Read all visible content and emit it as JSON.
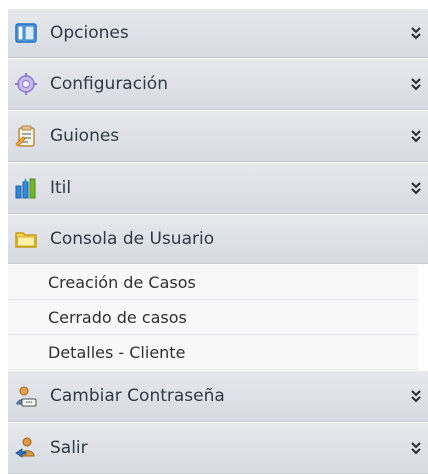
{
  "menu": {
    "headers": [
      {
        "label": "Opciones",
        "icon": "panel-icon"
      },
      {
        "label": "Configuración",
        "icon": "gear-icon"
      },
      {
        "label": "Guiones",
        "icon": "clipboard-icon"
      },
      {
        "label": "Itil",
        "icon": "bar-chart-icon"
      },
      {
        "label": "Consola de Usuario",
        "icon": "folder-icon"
      },
      {
        "label": "Cambiar Contraseña",
        "icon": "user-password-icon"
      },
      {
        "label": "Salir",
        "icon": "exit-user-icon"
      }
    ],
    "subitems": [
      {
        "label": "Creación de Casos"
      },
      {
        "label": "Cerrado de casos"
      },
      {
        "label": "Detalles - Cliente"
      }
    ],
    "colors": {
      "header_bg": "#dde0e5",
      "subitem_bg": "#f8f8f8",
      "text": "#2f3a47"
    }
  }
}
